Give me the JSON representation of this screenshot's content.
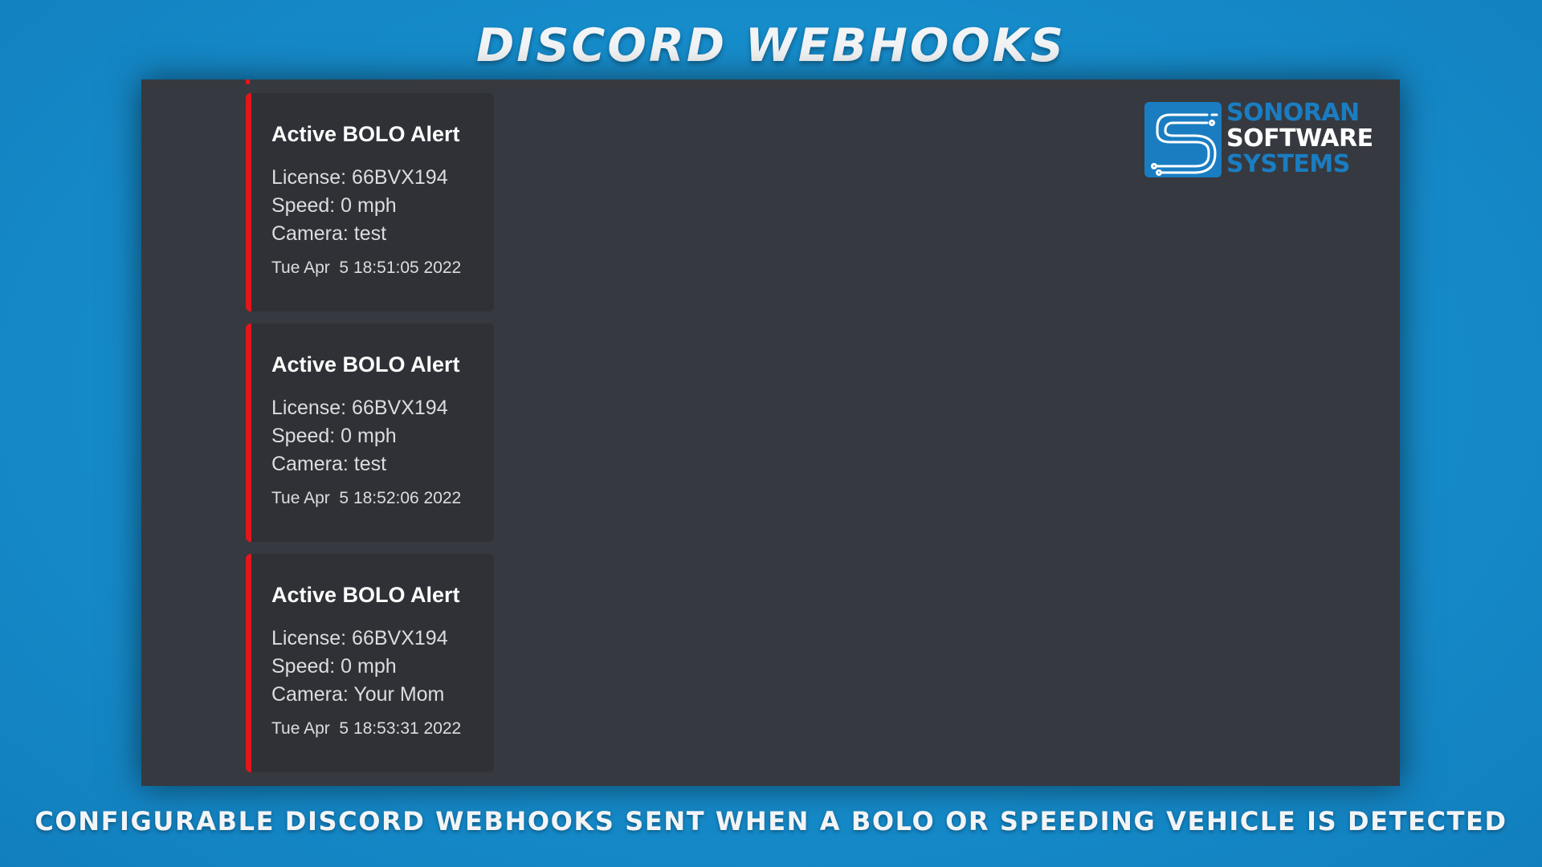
{
  "banner": {
    "title": "DISCORD WEBHOOKS",
    "subtitle": "CONFIGURABLE DISCORD WEBHOOKS SENT WHEN A BOLO OR SPEEDING VEHICLE IS DETECTED"
  },
  "logo": {
    "line1": "SONORAN",
    "line2": "SOFTWARE",
    "line3": "SYSTEMS",
    "icon": "sonoran-s-circuit-icon"
  },
  "colors": {
    "background_blue": "#168ccb",
    "discord_bg": "#36393f",
    "embed_bg": "#2f3136",
    "embed_accent": "#e3161b",
    "logo_blue": "#1a7dc2"
  },
  "embeds": [
    {
      "title": "Active BOLO Alert",
      "license": "License: 66BVX194",
      "speed": "Speed: 0 mph",
      "camera": "Camera: test",
      "timestamp": "Tue Apr  5 18:51:05 2022"
    },
    {
      "title": "Active BOLO Alert",
      "license": "License: 66BVX194",
      "speed": "Speed: 0 mph",
      "camera": "Camera: test",
      "timestamp": "Tue Apr  5 18:52:06 2022"
    },
    {
      "title": "Active BOLO Alert",
      "license": "License: 66BVX194",
      "speed": "Speed: 0 mph",
      "camera": "Camera: Your Mom",
      "timestamp": "Tue Apr  5 18:53:31 2022"
    }
  ]
}
